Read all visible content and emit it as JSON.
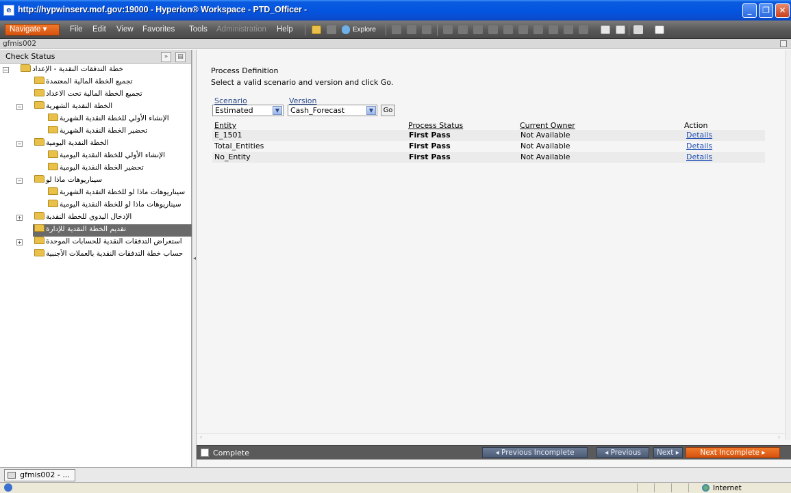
{
  "window": {
    "title": "http://hypwinserv.mof.gov:19000 - Hyperion® Workspace - PTD_Officer -"
  },
  "menubar": {
    "navigate": "Navigate ▾",
    "items": [
      "File",
      "Edit",
      "View",
      "Favorites",
      "Tools",
      "Administration",
      "Help"
    ],
    "explore": "Explore"
  },
  "tabstrip": {
    "label": "gfmis002"
  },
  "left_panel": {
    "title": "Check Status",
    "tree": [
      {
        "label": "خطة التدفقات النقدية - الإعداد",
        "level": 0,
        "toggle": "−"
      },
      {
        "label": "تجميع الخطة المالية المعتمدة",
        "level": 1,
        "toggle": ""
      },
      {
        "label": "تجميع الخطة المالية تحت الاعداد",
        "level": 1,
        "toggle": ""
      },
      {
        "label": "الخطة النقدية الشهرية",
        "level": 1,
        "toggle": "−"
      },
      {
        "label": "الإنشاء الأولي للخطة النقدية الشهرية",
        "level": 2,
        "toggle": ""
      },
      {
        "label": "تحضير الخطة النقدية الشهرية",
        "level": 2,
        "toggle": ""
      },
      {
        "label": "الخطة النقدية اليومية",
        "level": 1,
        "toggle": "−"
      },
      {
        "label": "الإنشاء الأولي للخطة النقدية اليومية",
        "level": 2,
        "toggle": ""
      },
      {
        "label": "تحضير الخطة النقدية اليومية",
        "level": 2,
        "toggle": ""
      },
      {
        "label": "سيناريوهات ماذا لو",
        "level": 1,
        "toggle": "−"
      },
      {
        "label": "سيناريوهات ماذا لو للخطة التقدية الشهرية",
        "level": 2,
        "toggle": ""
      },
      {
        "label": "سيناريوهات ماذا لو للخطة النقدية اليومية",
        "level": 2,
        "toggle": ""
      },
      {
        "label": "الإدخال اليدوي للخطة النقدية",
        "level": 1,
        "toggle": "+"
      },
      {
        "label": "تقديم الخطة النقدية للإدارة",
        "level": 1,
        "toggle": "",
        "selected": true
      },
      {
        "label": "استعراض التدفقات النقدية للحسابات الموحدة",
        "level": 1,
        "toggle": "+"
      },
      {
        "label": "حساب خطة التدفقات النقدية بالعملات الأجنبية",
        "level": 1,
        "toggle": ""
      }
    ]
  },
  "content": {
    "title": "Process Definition",
    "instruction": "Select a valid scenario and version and click Go.",
    "scenario_label": "Scenario",
    "scenario_value": "Estimated",
    "version_label": "Version",
    "version_value": "Cash_Forecast",
    "go_label": "Go",
    "columns": {
      "entity": "Entity",
      "status": "Process Status",
      "owner": "Current Owner",
      "action": "Action"
    },
    "rows": [
      {
        "entity": "E_1501",
        "status": "First Pass",
        "owner": "Not Available",
        "action": "Details"
      },
      {
        "entity": "Total_Entities",
        "status": "First Pass",
        "owner": "Not Available",
        "action": "Details"
      },
      {
        "entity": "No_Entity",
        "status": "First Pass",
        "owner": "Not Available",
        "action": "Details"
      }
    ]
  },
  "actionbar": {
    "complete_label": "Complete",
    "prev_incomplete": "◂ Previous Incomplete",
    "previous": "◂ Previous",
    "next": "Next ▸",
    "next_incomplete": "Next Incomplete ▸"
  },
  "taskbar": {
    "item": "gfmis002 - ..."
  },
  "statusbar": {
    "zone": "Internet"
  },
  "colors": {
    "accent_orange": "#e0621b",
    "titlebar_blue": "#0454e0",
    "menubar_gray": "#5a5a5a"
  }
}
